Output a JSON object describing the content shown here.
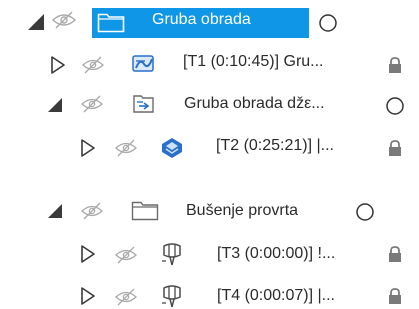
{
  "tree": {
    "items": [
      {
        "label": "Gruba obrada",
        "type": "setup",
        "expanded": true,
        "selected": true,
        "status": "circle"
      },
      {
        "label": "[T1 (0:10:45)] Gru...",
        "type": "operation",
        "expanded": false,
        "status": "lock"
      },
      {
        "label": "Gruba obrada džε...",
        "type": "setup",
        "expanded": true,
        "status": "circle"
      },
      {
        "label": "[T2 (0:25:21)] |...",
        "type": "operation",
        "expanded": false,
        "status": "lock"
      },
      {
        "label": "Bušenje provrta",
        "type": "setup",
        "expanded": true,
        "status": "circle"
      },
      {
        "label": "[T3 (0:00:00)] !...",
        "type": "operation",
        "expanded": false,
        "status": "lock"
      },
      {
        "label": "[T4 (0:00:07)] |...",
        "type": "operation",
        "expanded": false,
        "status": "lock"
      }
    ]
  },
  "colors": {
    "selection": "#0f96e6",
    "icon_blue": "#2a6fc9",
    "icon_gray": "#7a7a7a"
  }
}
